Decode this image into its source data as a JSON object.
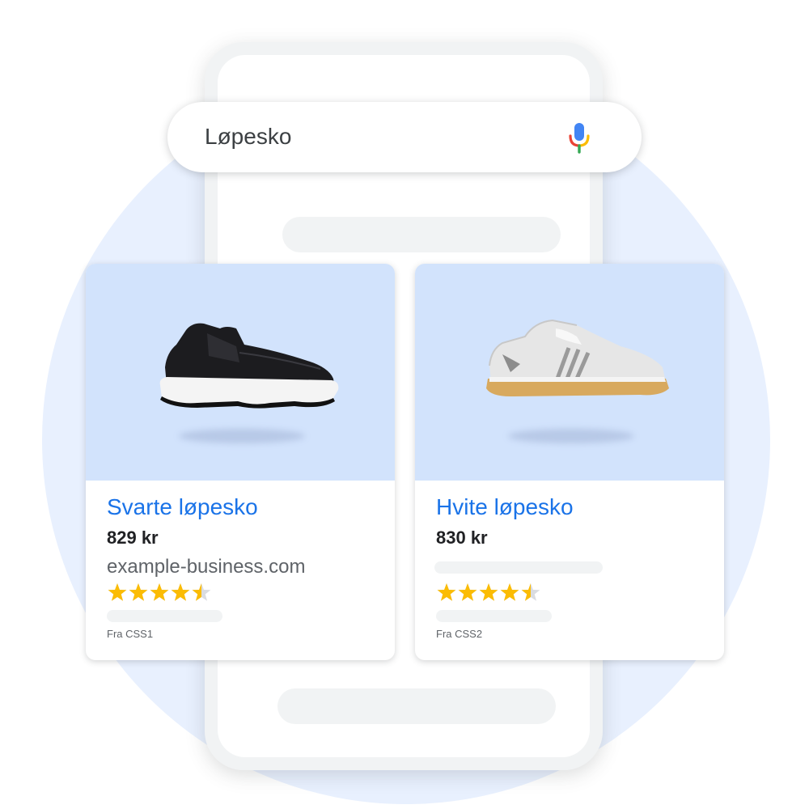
{
  "search": {
    "query": "Løpesko"
  },
  "cards": [
    {
      "title": "Svarte løpesko",
      "price": "829 kr",
      "domain": "example-business.com",
      "rating": 4.5,
      "source": "Fra CSS1",
      "shoe_color": "black"
    },
    {
      "title": "Hvite løpesko",
      "price": "830 kr",
      "rating": 4.5,
      "source": "Fra CSS2",
      "shoe_color": "white"
    }
  ],
  "colors": {
    "link": "#1a73e8",
    "star": "#fbbc04",
    "card_image_bg": "#d2e3fc",
    "background_circle": "#e8f0fe",
    "placeholder": "#f1f3f4"
  },
  "icons": {
    "search_voice": "mic-icon",
    "rating": "star-icon"
  }
}
